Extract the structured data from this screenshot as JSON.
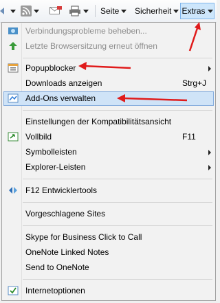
{
  "toolbar": {
    "items": [
      {
        "label": "Seite"
      },
      {
        "label": "Sicherheit"
      },
      {
        "label": "Extras"
      }
    ]
  },
  "menu": {
    "items": [
      {
        "label": "Verbindungsprobleme beheben...",
        "disabled": true,
        "icon": "network-repair-icon"
      },
      {
        "label": "Letzte Browsersitzung erneut öffnen",
        "disabled": true,
        "icon": "reopen-session-icon"
      },
      {
        "label": "Popupblocker",
        "submenu": true,
        "icon": "popup-blocker-icon"
      },
      {
        "label": "Downloads anzeigen",
        "shortcut": "Strg+J"
      },
      {
        "label": "Add-Ons verwalten",
        "highlighted": true,
        "icon": "addons-icon"
      },
      {
        "label": "Einstellungen der Kompatibilitätsansicht"
      },
      {
        "label": "Vollbild",
        "shortcut": "F11",
        "icon": "fullscreen-icon"
      },
      {
        "label": "Symbolleisten",
        "submenu": true
      },
      {
        "label": "Explorer-Leisten",
        "submenu": true
      },
      {
        "label": "F12 Entwicklertools",
        "icon": "developer-tools-icon"
      },
      {
        "label": "Vorgeschlagene Sites"
      },
      {
        "label": "Skype for Business Click to Call"
      },
      {
        "label": "OneNote Linked Notes"
      },
      {
        "label": "Send to OneNote"
      },
      {
        "label": "Internetoptionen",
        "icon": "internet-options-icon"
      }
    ]
  },
  "colors": {
    "highlight_bg": "#cfe3f7",
    "highlight_border": "#84acdd",
    "annotation_red": "#e01b1b"
  }
}
